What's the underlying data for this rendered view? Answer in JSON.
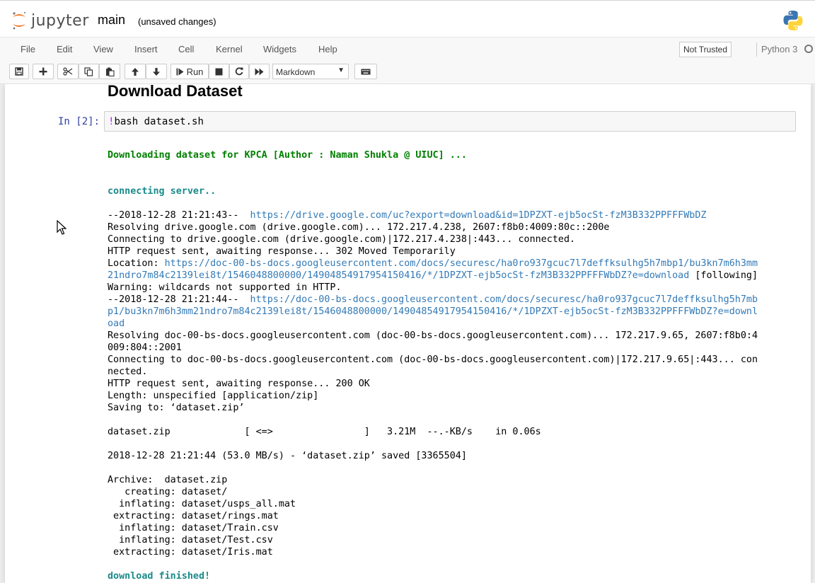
{
  "header": {
    "logo_text": "jupyter",
    "notebook_name": "main",
    "save_status": "(unsaved changes)"
  },
  "menubar": {
    "items": [
      "File",
      "Edit",
      "View",
      "Insert",
      "Cell",
      "Kernel",
      "Widgets",
      "Help"
    ],
    "trust_label": "Not Trusted",
    "kernel_name": "Python 3"
  },
  "toolbar": {
    "run_label": "Run",
    "cell_type": "Markdown",
    "icons": [
      "save-icon",
      "plus-icon",
      "cut-icon",
      "copy-icon",
      "paste-icon",
      "arrow-up-icon",
      "arrow-down-icon",
      "step-forward-icon",
      "stop-icon",
      "restart-icon",
      "fast-forward-icon",
      "keyboard-icon"
    ]
  },
  "notebook": {
    "heading": "Download Dataset",
    "in_prompt": "In [2]:",
    "code_bang": "!",
    "code_rest": "bash dataset.sh",
    "output": {
      "downloading": "Downloading dataset for KPCA [Author : Naman Shukla @ UIUC] ...",
      "connecting": "connecting server..",
      "l1_prefix": "--2018-12-28 21:21:43--  ",
      "l1_link": "https://drive.google.com/uc?export=download&id=1DPZXT-ejb5ocSt-fzM3B332PPFFFWbDZ",
      "l2": "Resolving drive.google.com (drive.google.com)... 172.217.4.238, 2607:f8b0:4009:80c::200e",
      "l3": "Connecting to drive.google.com (drive.google.com)|172.217.4.238|:443... connected.",
      "l4": "HTTP request sent, awaiting response... 302 Moved Temporarily",
      "l5_prefix": "Location: ",
      "l5_link_a": "https://doc-00-bs-docs.googleusercontent.com/docs/securesc/ha0ro937gcuc7l7deffksulhg5h7mbp1/bu3kn7m6h3mm",
      "l5_link_b": "21ndro7m84c2139lei8t/1546048800000/14904854917954150416/*/1DPZXT-ejb5ocSt-fzM3B332PPFFFWbDZ?e=download",
      "l5_suffix": " [following]",
      "l6": "Warning: wildcards not supported in HTTP.",
      "l7_prefix": "--2018-12-28 21:21:44--  ",
      "l7_link_a": "https://doc-00-bs-docs.googleusercontent.com/docs/securesc/ha0ro937gcuc7l7deffksulhg5h7mb",
      "l7_link_b": "p1/bu3kn7m6h3mm21ndro7m84c2139lei8t/1546048800000/14904854917954150416/*/1DPZXT-ejb5ocSt-fzM3B332PPFFFWbDZ?e=downl",
      "l7_link_c": "oad",
      "l8a": "Resolving doc-00-bs-docs.googleusercontent.com (doc-00-bs-docs.googleusercontent.com)... 172.217.9.65, 2607:f8b0:4",
      "l8b": "009:804::2001",
      "l9a": "Connecting to doc-00-bs-docs.googleusercontent.com (doc-00-bs-docs.googleusercontent.com)|172.217.9.65|:443... con",
      "l9b": "nected.",
      "l10": "HTTP request sent, awaiting response... 200 OK",
      "l11": "Length: unspecified [application/zip]",
      "l12": "Saving to: ‘dataset.zip’",
      "l13": "dataset.zip             [ <=>                ]   3.21M  --.-KB/s    in 0.06s",
      "l14": "2018-12-28 21:21:44 (53.0 MB/s) - ‘dataset.zip’ saved [3365504]",
      "l15": "Archive:  dataset.zip",
      "l16": "   creating: dataset/",
      "l17": "  inflating: dataset/usps_all.mat",
      "l18": " extracting: dataset/rings.mat",
      "l19": "  inflating: dataset/Train.csv",
      "l20": "  inflating: dataset/Test.csv",
      "l21": " extracting: dataset/Iris.mat",
      "finished": "download finished!"
    }
  }
}
